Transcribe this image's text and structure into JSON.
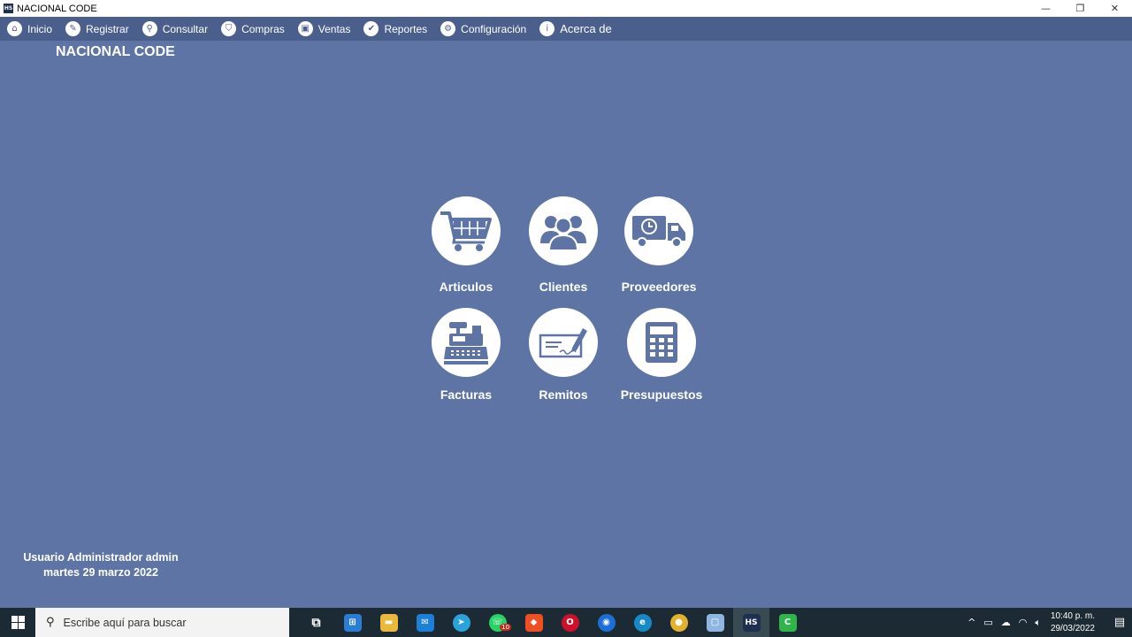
{
  "window": {
    "title": "NACIONAL CODE",
    "app_icon": "HS",
    "minimize": "—",
    "maximize": "❐",
    "close": "✕"
  },
  "menu": {
    "items": [
      {
        "label": "Inicio",
        "icon": "home-icon",
        "glyph": "⌂"
      },
      {
        "label": "Registrar",
        "icon": "pencil-icon",
        "glyph": "✎"
      },
      {
        "label": "Consultar",
        "icon": "search-icon",
        "glyph": "⚲"
      },
      {
        "label": "Compras",
        "icon": "basket-icon",
        "glyph": "⛉"
      },
      {
        "label": "Ventas",
        "icon": "register-icon",
        "glyph": "▣"
      },
      {
        "label": "Reportes",
        "icon": "clipboard-icon",
        "glyph": "✔"
      },
      {
        "label": "Configuración",
        "icon": "gear-icon",
        "glyph": "⚙"
      },
      {
        "label": "Acerca de",
        "icon": "info-icon",
        "glyph": "i"
      }
    ]
  },
  "brand": "NACIONAL CODE",
  "tiles": [
    {
      "label": "Articulos",
      "icon": "shopping-cart-icon"
    },
    {
      "label": "Clientes",
      "icon": "users-icon"
    },
    {
      "label": "Proveedores",
      "icon": "delivery-truck-icon"
    },
    {
      "label": "Facturas",
      "icon": "cash-register-icon"
    },
    {
      "label": "Remitos",
      "icon": "signed-document-icon"
    },
    {
      "label": "Presupuestos",
      "icon": "calculator-icon"
    }
  ],
  "user": {
    "line1": "Usuario Administrador admin",
    "line2": "martes 29 marzo 2022"
  },
  "taskbar": {
    "search_placeholder": "Escribe aquí para buscar",
    "apps": [
      {
        "name": "task-view",
        "glyph": "⧉",
        "color": "transparent"
      },
      {
        "name": "microsoft-store",
        "glyph": "⊞",
        "color": "#2b7cd3"
      },
      {
        "name": "file-explorer",
        "glyph": "▬",
        "color": "#e8b93a"
      },
      {
        "name": "mail",
        "glyph": "✉",
        "color": "#1e7fd9"
      },
      {
        "name": "telegram",
        "glyph": "➤",
        "color": "#2aa3dc"
      },
      {
        "name": "whatsapp",
        "glyph": "☏",
        "color": "#25d366",
        "badge": "10"
      },
      {
        "name": "brave",
        "glyph": "◆",
        "color": "#f04e23"
      },
      {
        "name": "opera",
        "glyph": "O",
        "color": "#d0102a"
      },
      {
        "name": "firefox",
        "glyph": "◉",
        "color": "#1d6fd6"
      },
      {
        "name": "edge",
        "glyph": "e",
        "color": "#1789c8"
      },
      {
        "name": "chrome",
        "glyph": "●",
        "color": "#e2b22a"
      },
      {
        "name": "virtualbox",
        "glyph": "▢",
        "color": "#8fb6e0"
      },
      {
        "name": "nacional-code-app",
        "glyph": "HS",
        "color": "#1f2f4f"
      },
      {
        "name": "camtasia",
        "glyph": "C",
        "color": "#2fb54a"
      }
    ],
    "clock_time": "10:40 p. m.",
    "clock_date": "29/03/2022"
  }
}
